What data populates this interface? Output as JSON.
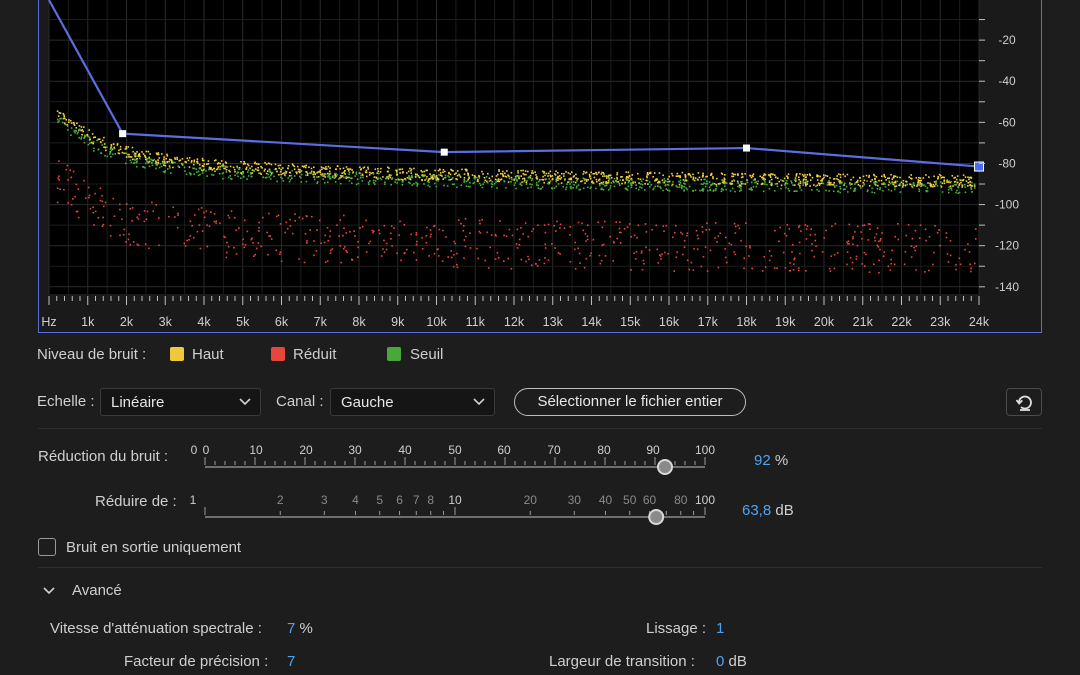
{
  "graph": {
    "freq_labels": [
      "Hz",
      "1k",
      "2k",
      "3k",
      "4k",
      "5k",
      "6k",
      "7k",
      "8k",
      "9k",
      "10k",
      "11k",
      "12k",
      "13k",
      "14k",
      "15k",
      "16k",
      "17k",
      "18k",
      "19k",
      "20k",
      "21k",
      "22k",
      "23k",
      "24k"
    ],
    "db_labels": [
      "-20",
      "-40",
      "-60",
      "-80",
      "-100",
      "-120",
      "-140"
    ],
    "threshold_curve": [
      {
        "freq_khz": 0.0,
        "db": -0.5
      },
      {
        "freq_khz": 1.9,
        "db": -65.5
      },
      {
        "freq_khz": 10.2,
        "db": -74.5
      },
      {
        "freq_khz": 18.0,
        "db": -72.5
      },
      {
        "freq_khz": 24.0,
        "db": -81.5
      }
    ],
    "colors": {
      "curve": "#5a6ee0",
      "high": "#f0d040",
      "reduced": "#e8463c",
      "threshold": "#48b040"
    }
  },
  "legend": {
    "title": "Niveau de bruit :",
    "items": [
      {
        "label": "Haut",
        "color": "#f0c83a"
      },
      {
        "label": "Réduit",
        "color": "#e8463c"
      },
      {
        "label": "Seuil",
        "color": "#48a83a"
      }
    ]
  },
  "controls": {
    "scale_label": "Echelle :",
    "scale_value": "Linéaire",
    "channel_label": "Canal :",
    "channel_value": "Gauche",
    "select_file_button": "Sélectionner le fichier entier"
  },
  "noise_reduction": {
    "label": "Réduction du bruit :",
    "scale": [
      "0",
      "0",
      "10",
      "20",
      "30",
      "40",
      "50",
      "60",
      "70",
      "80",
      "90",
      "100"
    ],
    "value": "92",
    "value_number": 92,
    "unit": "%"
  },
  "reduce_by": {
    "label": "Réduire de :",
    "scale": [
      "1",
      "2",
      "3",
      "4",
      "5",
      "6",
      "7",
      "8",
      "10",
      "20",
      "30",
      "40",
      "50",
      "60",
      "80",
      "100"
    ],
    "value": "63,8",
    "value_number": 63.8,
    "unit": "dB"
  },
  "output_noise_only": {
    "label": "Bruit en sortie uniquement",
    "checked": false
  },
  "advanced": {
    "title": "Avancé",
    "spectral_decay_label": "Vitesse d'atténuation spectrale :",
    "spectral_decay_value": "7",
    "spectral_decay_unit": "%",
    "smoothing_label": "Lissage :",
    "smoothing_value": "1",
    "precision_label": "Facteur de précision :",
    "precision_value": "7",
    "transition_label": "Largeur de transition :",
    "transition_value": "0",
    "transition_unit": "dB"
  }
}
